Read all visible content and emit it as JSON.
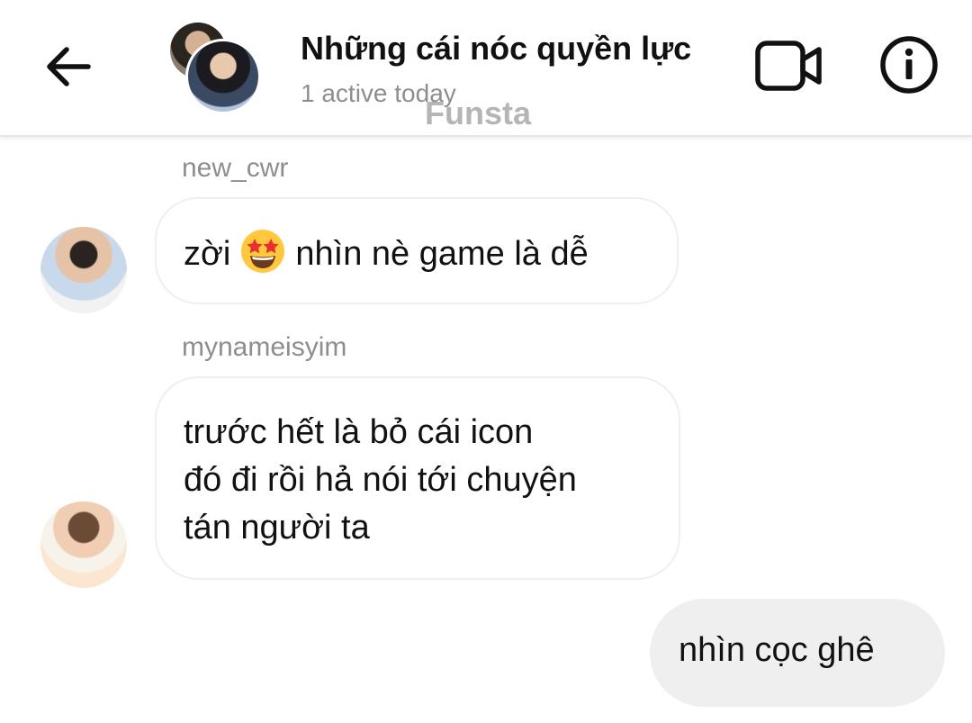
{
  "header": {
    "title": "Những cái nóc quyền lực",
    "subtitle": "1 active today",
    "watermark": "Funsta",
    "icons": {
      "back": "arrow-left-icon",
      "video": "video-camera-icon",
      "info": "info-icon"
    }
  },
  "messages": [
    {
      "sender": "new_cwr",
      "segments": [
        "zời",
        "star-struck-emoji",
        "nhìn nè game là dễ"
      ]
    },
    {
      "sender": "mynameisyim",
      "lines": [
        "trước hết là bỏ cái icon",
        "đó đi rồi hả nói tới chuyện",
        "tán người ta"
      ]
    },
    {
      "text": "nhìn cọc ghê"
    }
  ]
}
